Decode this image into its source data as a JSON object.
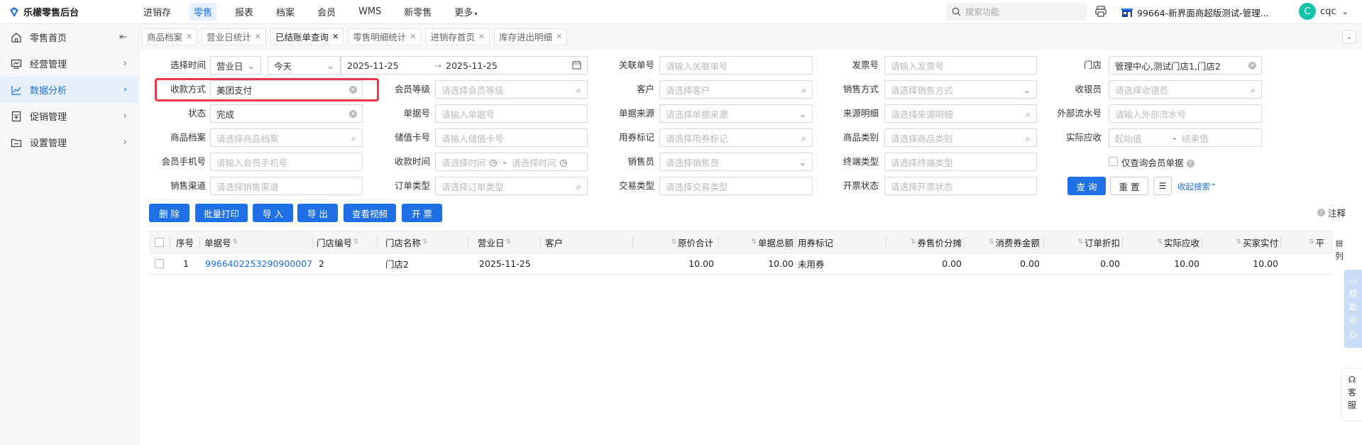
{
  "header": {
    "brand": "乐檬零售后台",
    "nav": [
      "进销存",
      "零售",
      "报表",
      "档案",
      "会员",
      "WMS",
      "新零售",
      "更多"
    ],
    "active_nav": "零售",
    "search_placeholder": "搜索功能",
    "store": "99664-新界面商超版测试-管理...",
    "avatar_letter": "C",
    "user": "cqc"
  },
  "sidebar": {
    "items": [
      {
        "label": "零售首页",
        "icon": "home-icon"
      },
      {
        "label": "经营管理",
        "icon": "chart-board-icon"
      },
      {
        "label": "数据分析",
        "icon": "line-chart-icon"
      },
      {
        "label": "促销管理",
        "icon": "coupon-icon"
      },
      {
        "label": "设置管理",
        "icon": "folder-icon"
      }
    ],
    "active": "数据分析"
  },
  "tabs": [
    "商品档案",
    "营业日统计",
    "已结账单查询",
    "零售明细统计",
    "进销存首页",
    "库存进出明细"
  ],
  "active_tab": "已结账单查询",
  "filters": {
    "select_time_label": "选择时间",
    "time_type": "营业日",
    "time_range": "今天",
    "date_start": "2025-11-25",
    "date_sep": "→",
    "date_end": "2025-11-25",
    "related_no_label": "关联单号",
    "related_no_ph": "请输入关联单号",
    "invoice_no_label": "发票号",
    "invoice_no_ph": "请输入发票号",
    "store_label": "门店",
    "store_value": "管理中心,测试门店1,门店2",
    "payment_label": "收款方式",
    "payment_value": "美团支付",
    "member_level_label": "会员等级",
    "member_level_ph": "请选择会员等级",
    "customer_label": "客户",
    "customer_ph": "请选择客户",
    "sale_method_label": "销售方式",
    "sale_method_ph": "请选择销售方式",
    "cashier_label": "收银员",
    "cashier_ph": "请选择收银员",
    "status_label": "状态",
    "status_value": "完成",
    "doc_no_label": "单据号",
    "doc_no_ph": "请输入单据号",
    "doc_source_label": "单据来源",
    "doc_source_ph": "请选择单据来源",
    "source_detail_label": "来源明细",
    "source_detail_ph": "请选择来源明细",
    "ext_serial_label": "外部流水号",
    "ext_serial_ph": "请输入外部流水号",
    "product_label": "商品档案",
    "product_ph": "请选择商品档案",
    "stored_card_label": "储值卡号",
    "stored_card_ph": "请输入储值卡号",
    "coupon_mark_label": "用券标记",
    "coupon_mark_ph": "请选择用券标记",
    "category_label": "商品类别",
    "category_ph": "请选择商品类别",
    "receivable_label": "实际应收",
    "receivable_start_ph": "起始值",
    "receivable_sep": "-",
    "receivable_end_ph": "结束值",
    "member_phone_label": "会员手机号",
    "member_phone_ph": "请输入会员手机号",
    "pay_time_label": "收款时间",
    "pay_time_start_ph": "请选择时间",
    "pay_time_sep": "-",
    "pay_time_end_ph": "请选择时间",
    "salesperson_label": "销售员",
    "salesperson_ph": "请选择销售员",
    "terminal_label": "终端类型",
    "terminal_ph": "请选择终端类型",
    "member_only_label": "仅查询会员单据",
    "channel_label": "销售渠道",
    "channel_ph": "请选择销售渠道",
    "order_type_label": "订单类型",
    "order_type_ph": "请选择订单类型",
    "trade_type_label": "交易类型",
    "trade_type_ph": "请选择交易类型",
    "invoice_status_label": "开票状态",
    "invoice_status_ph": "请选择开票状态",
    "query_btn": "查 询",
    "reset_btn": "重 置",
    "collapse_link": "收起搜索"
  },
  "actions": [
    "删 除",
    "批量打印",
    "导 入",
    "导 出",
    "查看视频",
    "开 票"
  ],
  "note_label": "注释",
  "table": {
    "columns": [
      "序号",
      "单据号",
      "门店编号",
      "门店名称",
      "营业日",
      "客户",
      "原价合计",
      "单据总额",
      "用券标记",
      "券售价分摊",
      "消费券金额",
      "订单折扣",
      "实际应收",
      "买家实付",
      "平"
    ],
    "rows": [
      [
        "1",
        "9966402253290900007",
        "2",
        "门店2",
        "2025-11-25",
        "",
        "10.00",
        "10.00",
        "未用券",
        "0.00",
        "0.00",
        "0.00",
        "10.00",
        "10.00"
      ]
    ]
  },
  "col_setting": [
    "列"
  ],
  "help_center": [
    "帮",
    "助",
    "中",
    "心"
  ],
  "service": [
    "客",
    "服"
  ]
}
